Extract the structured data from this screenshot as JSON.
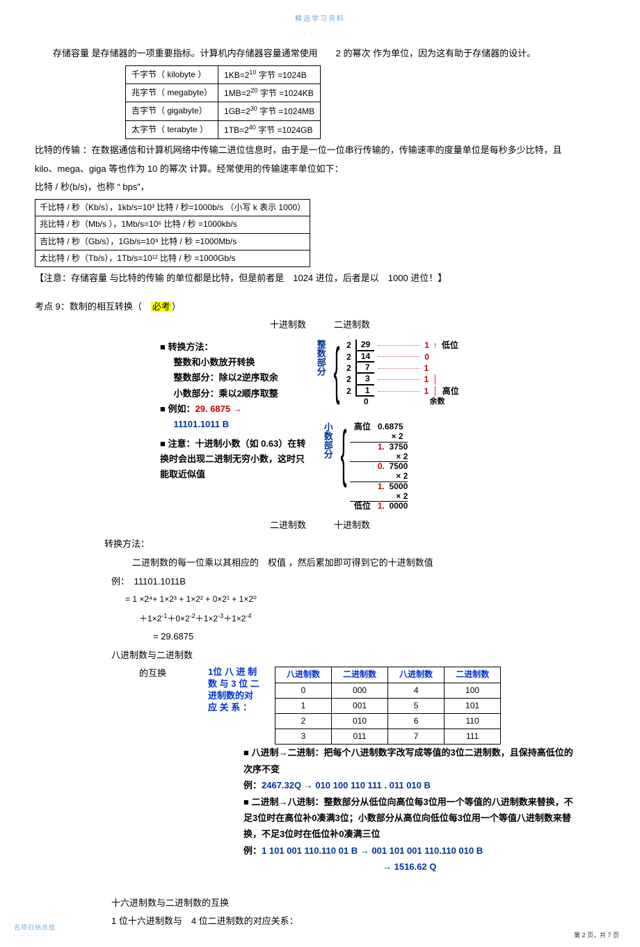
{
  "header": {
    "top": "精选学习资料",
    "sub": "- - - - - - - - -"
  },
  "p1": "存储容量 是存储器的一项重要指标。计算机内存储器容量通常使用　　2 的幂次 作为单位，因为这有助于存储器的设计。",
  "storage_table": [
    {
      "name": "千字节（ kilobyte ）",
      "val_a": "1KB=2",
      "val_sup": "10",
      "val_b": " 字节 =1024B"
    },
    {
      "name": "兆字节（ megabyte）",
      "val_a": "1MB=2",
      "val_sup": "20",
      "val_b": " 字节 =1024KB"
    },
    {
      "name": "吉字节（ gigabyte）",
      "val_a": "1GB=2",
      "val_sup": "30",
      "val_b": " 字节 =1024MB"
    },
    {
      "name": "太字节（ terabyte ）",
      "val_a": "1TB=2",
      "val_sup": "40",
      "val_b": " 字节 =1024GB"
    }
  ],
  "p2": "比特的传输 ：在数据通信和计算机网络中传输二进位信息时，由于是一位一位串行传输的，传输速率的度量单位是每秒多少比特，且",
  "p3": "kilo、mega、giga 等也作为  10 的幂次 计算。经常使用的传输速率单位如下：",
  "p4": "比特 / 秒(b/s)，也称 “ bps”，",
  "bitrate_table": [
    "千比特 / 秒（Kb/s），1kb/s=10³ 比特 / 秒=1000b/s （小写  k 表示  1000）",
    "兆比特 / 秒（Mb/s ），1Mb/s=10⁶ 比特 / 秒 =1000kb/s",
    "吉比特 / 秒（Gb/s），1Gb/s=10⁹ 比特 / 秒 =1000Mb/s",
    "太比特 / 秒（Tb/s），1Tb/s=10¹² 比特 / 秒 =1000Gb/s"
  ],
  "note": "【注意：存储容量  与比特的传输 的单位都是比特，但是前者是　1024 进位，后者是以　1000 进位！】",
  "kp9_a": "考点 9：数制的相互转换（　",
  "kp9_hl": "必考",
  "kp9_b": "）",
  "lbl_dec": "十进制数",
  "lbl_bin": "二进制数",
  "method": {
    "t1": "转换方法：",
    "s1": "整数和小数放开转换",
    "s2": "整数部分：除以2逆序取余",
    "s3": "小数部分：乘以2顺序取整",
    "t2a": "例如：",
    "t2r": "29. 6875 →",
    "t2b": "11101.1011 B",
    "t3": "注意：十进制小数（如 0.63）在转换时会出现二进制无穷小数，这时只能取近似值"
  },
  "int_steps": {
    "brace_label": "整数部分",
    "rows": [
      {
        "d": "2",
        "n": "29",
        "r": "1",
        "tag": "低位"
      },
      {
        "d": "2",
        "n": "14",
        "r": "0",
        "tag": ""
      },
      {
        "d": "2",
        "n": "7",
        "r": "1",
        "tag": ""
      },
      {
        "d": "2",
        "n": "3",
        "r": "1",
        "tag": ""
      },
      {
        "d": "2",
        "n": "1",
        "r": "1",
        "tag": "高位"
      },
      {
        "d": "",
        "n": "0",
        "r": "",
        "tag": "余数"
      }
    ]
  },
  "frac_steps": {
    "brace_label": "小数部分",
    "start": "0.6875",
    "rows": [
      {
        "bit": "1.",
        "v": "3750",
        "side": "高位"
      },
      {
        "bit": "0.",
        "v": "7500",
        "side": ""
      },
      {
        "bit": "1.",
        "v": "5000",
        "side": ""
      },
      {
        "bit": "1.",
        "v": "0000",
        "side": "低位"
      }
    ],
    "mul": "× 2"
  },
  "conv_title": "转换方法：",
  "conv_rule": "二进制数的每一位乘以其相应的　权值 ，然后累加即可得到它的十进制数值",
  "ex_lbl": "例：　11101.1011B",
  "ex_l1": "= 1 ×2⁴+ 1×2³ + 1×2² + 0×2¹ + 1×2⁰",
  "ex_l2_a": "＋1×2",
  "ex_l2_sup1": "-1",
  "ex_l2_b": "＋0×2",
  "ex_l2_sup2": "-2",
  "ex_l2_c": "＋1×2",
  "ex_l2_sup3": "-3",
  "ex_l2_d": "＋1×2",
  "ex_l2_sup4": "-4",
  "ex_res": "= 29.6875",
  "oct_title": "八进制数与二进制数",
  "oct_sub": "的互换",
  "oct_left": "1位 八 进 制 数 与 3 位 二 进制数的对 应 关 系 ：",
  "oct_headers": [
    "八进制数",
    "二进制数",
    "八进制数",
    "二进制数"
  ],
  "oct_rows": [
    [
      "0",
      "000",
      "4",
      "100"
    ],
    [
      "1",
      "001",
      "5",
      "101"
    ],
    [
      "2",
      "010",
      "6",
      "110"
    ],
    [
      "3",
      "011",
      "7",
      "111"
    ]
  ],
  "rule1": "八进制→二进制：把每个八进制数字改写成等值的3位二进制数，且保持高低位的次序不变",
  "rule1_ex_lbl": "例：",
  "rule1_ex": "2467.32Q → 010 100 110 111 . 011 010 B",
  "rule2": "二进制→八进制：整数部分从低位向高位每3位用一个等值的八进制数来替换，不足3位时在高位补0凑满3位；小数部分从高位向低位每3位用一个等值八进制数来替换，不足3位时在低位补0凑满三位",
  "rule2_ex_lbl": "例：",
  "rule2_ex1": "1 101 001 110.110 01 B  → 001 101 001 110.110 010 B",
  "rule2_ex2": "→ 1516.62 Q",
  "hex_title": "十六进制数与二进制数的互换",
  "hex_sub": "1 位十六进制数与　4 位二进制数的对应关系：",
  "footer_left": "名师归纳总结",
  "footer_left2": "- - - - - - -",
  "footer_right": "第 2 页，共 7 页"
}
